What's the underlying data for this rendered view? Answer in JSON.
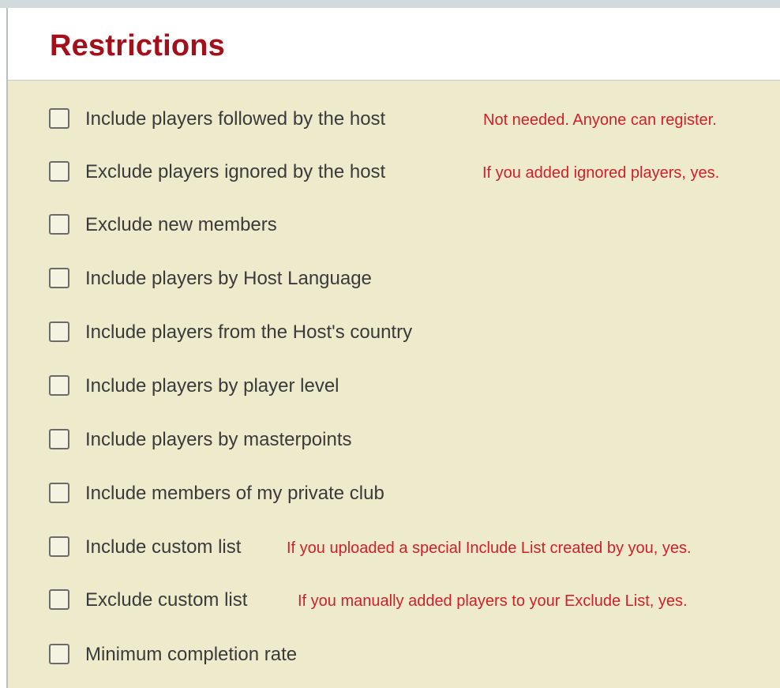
{
  "title": "Restrictions",
  "colors": {
    "title": "#a3101a",
    "note": "#d21e2a",
    "panel_bg": "#eeebcd",
    "label": "#3a3a3a"
  },
  "restrictions": [
    {
      "label": "Include players followed by the host",
      "checked": false,
      "note": "Not needed. Anyone can register."
    },
    {
      "label": "Exclude players ignored by the host",
      "checked": false,
      "note": "If you added ignored players, yes."
    },
    {
      "label": "Exclude new members",
      "checked": false,
      "note": ""
    },
    {
      "label": "Include players by Host Language",
      "checked": false,
      "note": ""
    },
    {
      "label": "Include players from the Host's country",
      "checked": false,
      "note": ""
    },
    {
      "label": "Include players by player level",
      "checked": false,
      "note": ""
    },
    {
      "label": "Include players by masterpoints",
      "checked": false,
      "note": ""
    },
    {
      "label": "Include members of my private club",
      "checked": false,
      "note": ""
    },
    {
      "label": "Include custom list",
      "checked": false,
      "note": "If you uploaded a special Include List created by you, yes."
    },
    {
      "label": "Exclude custom list",
      "checked": false,
      "note": "If you manually added players to your Exclude List, yes."
    },
    {
      "label": "Minimum completion rate",
      "checked": false,
      "note": ""
    }
  ]
}
